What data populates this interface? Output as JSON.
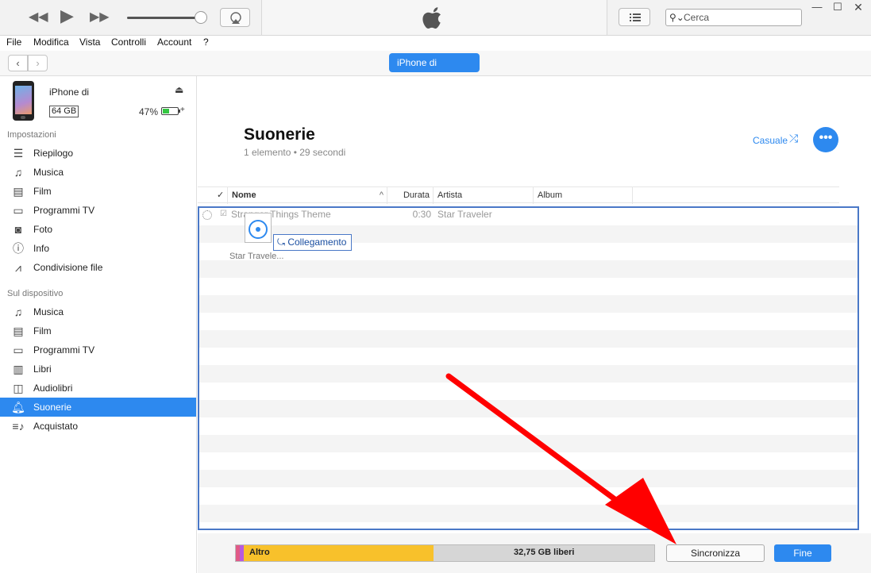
{
  "player": {
    "rewind_icon": "rewind-icon",
    "play_icon": "play-icon",
    "forward_icon": "fast-forward-icon",
    "airplay_icon": "airplay-icon",
    "apple_icon": "apple-logo",
    "list_icon": "list-icon",
    "search_placeholder": "Cerca"
  },
  "window": {
    "minimize": "—",
    "maximize": "☐",
    "close": "✕"
  },
  "menu": [
    "File",
    "Modifica",
    "Vista",
    "Controlli",
    "Account",
    "?"
  ],
  "nav": {
    "back": "‹",
    "forward": "›",
    "device_pill": "iPhone di"
  },
  "device": {
    "name": "iPhone di",
    "capacity": "64 GB",
    "battery_percent": "47%",
    "battery_level": 0.47
  },
  "sidebar": {
    "settings_header": "Impostazioni",
    "settings": [
      {
        "label": "Riepilogo",
        "icon": "summary-icon"
      },
      {
        "label": "Musica",
        "icon": "music-note-icon"
      },
      {
        "label": "Film",
        "icon": "film-icon"
      },
      {
        "label": "Programmi TV",
        "icon": "tv-icon"
      },
      {
        "label": "Foto",
        "icon": "camera-icon"
      },
      {
        "label": "Info",
        "icon": "info-icon"
      },
      {
        "label": "Condivisione file",
        "icon": "apps-icon"
      }
    ],
    "device_header": "Sul dispositivo",
    "on_device": [
      {
        "label": "Musica",
        "icon": "music-note-icon"
      },
      {
        "label": "Film",
        "icon": "film-icon"
      },
      {
        "label": "Programmi TV",
        "icon": "tv-icon"
      },
      {
        "label": "Libri",
        "icon": "book-icon"
      },
      {
        "label": "Audiolibri",
        "icon": "audiobook-icon"
      },
      {
        "label": "Suonerie",
        "icon": "bell-icon",
        "active": true
      },
      {
        "label": "Acquistato",
        "icon": "purchased-icon"
      }
    ]
  },
  "content": {
    "title": "Suonerie",
    "subtitle": "1 elemento • 29 secondi",
    "shuffle_label": "Casuale",
    "more_label": "•••",
    "columns": {
      "check": "✓",
      "name": "Nome",
      "sort": "^",
      "duration": "Durata",
      "artist": "Artista",
      "album": "Album"
    },
    "tracks": [
      {
        "name": "Stranger Things Theme",
        "duration": "0:30",
        "artist": "Star Traveler"
      }
    ],
    "drag_file_label": "Star Travele...",
    "drag_tooltip": "Collegamento"
  },
  "footer": {
    "other_label": "Altro",
    "free_label": "32,75 GB liberi",
    "sync_button": "Sincronizza",
    "done_button": "Fine"
  },
  "colors": {
    "accent": "#2d89ef",
    "other_storage": "#f8c12b",
    "arrow": "#ff0000"
  }
}
